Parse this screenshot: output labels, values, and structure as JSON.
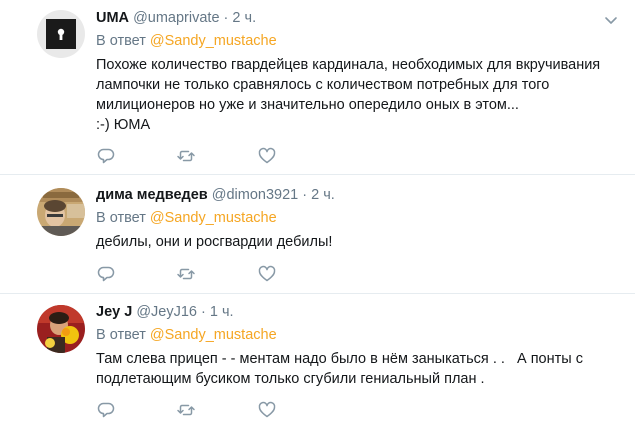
{
  "tweets": [
    {
      "name": "UMA",
      "handle": "@umaprivate",
      "separator": "·",
      "time": "2 ч.",
      "reply_prefix": "В ответ",
      "reply_mention": "@Sandy_mustache",
      "text_lines": [
        "Похоже количество гвардейцев кардинала, необходимых для вкручивания",
        "лампочки не только сравнялось с количеством потребных для того",
        "милиционеров но уже и значительно опередило оных в этом...",
        ":-) ЮМА"
      ]
    },
    {
      "name": "дима медведев",
      "handle": "@dimon3921",
      "separator": "·",
      "time": "2 ч.",
      "reply_prefix": "В ответ",
      "reply_mention": "@Sandy_mustache",
      "text_lines": [
        "дебилы, они и росгвардии дебилы!"
      ]
    },
    {
      "name": "Jey J",
      "handle": "@JeyJ16",
      "separator": "·",
      "time": "1 ч.",
      "reply_prefix": "В ответ",
      "reply_mention": "@Sandy_mustache",
      "text_lines": [
        "Там слева прицеп - - ментам надо было в нём заныкаться . .   А понты с",
        "подлетающим бусиком только сгубили гениальный план ."
      ]
    }
  ],
  "icons": {
    "reply": "reply-icon",
    "retweet": "retweet-icon",
    "like": "heart-icon",
    "more": "chevron-down-icon"
  },
  "colors": {
    "accent_mention": "#f5a623",
    "secondary_text": "#657786",
    "primary_text": "#14171a",
    "divider": "#e6ecf0"
  }
}
